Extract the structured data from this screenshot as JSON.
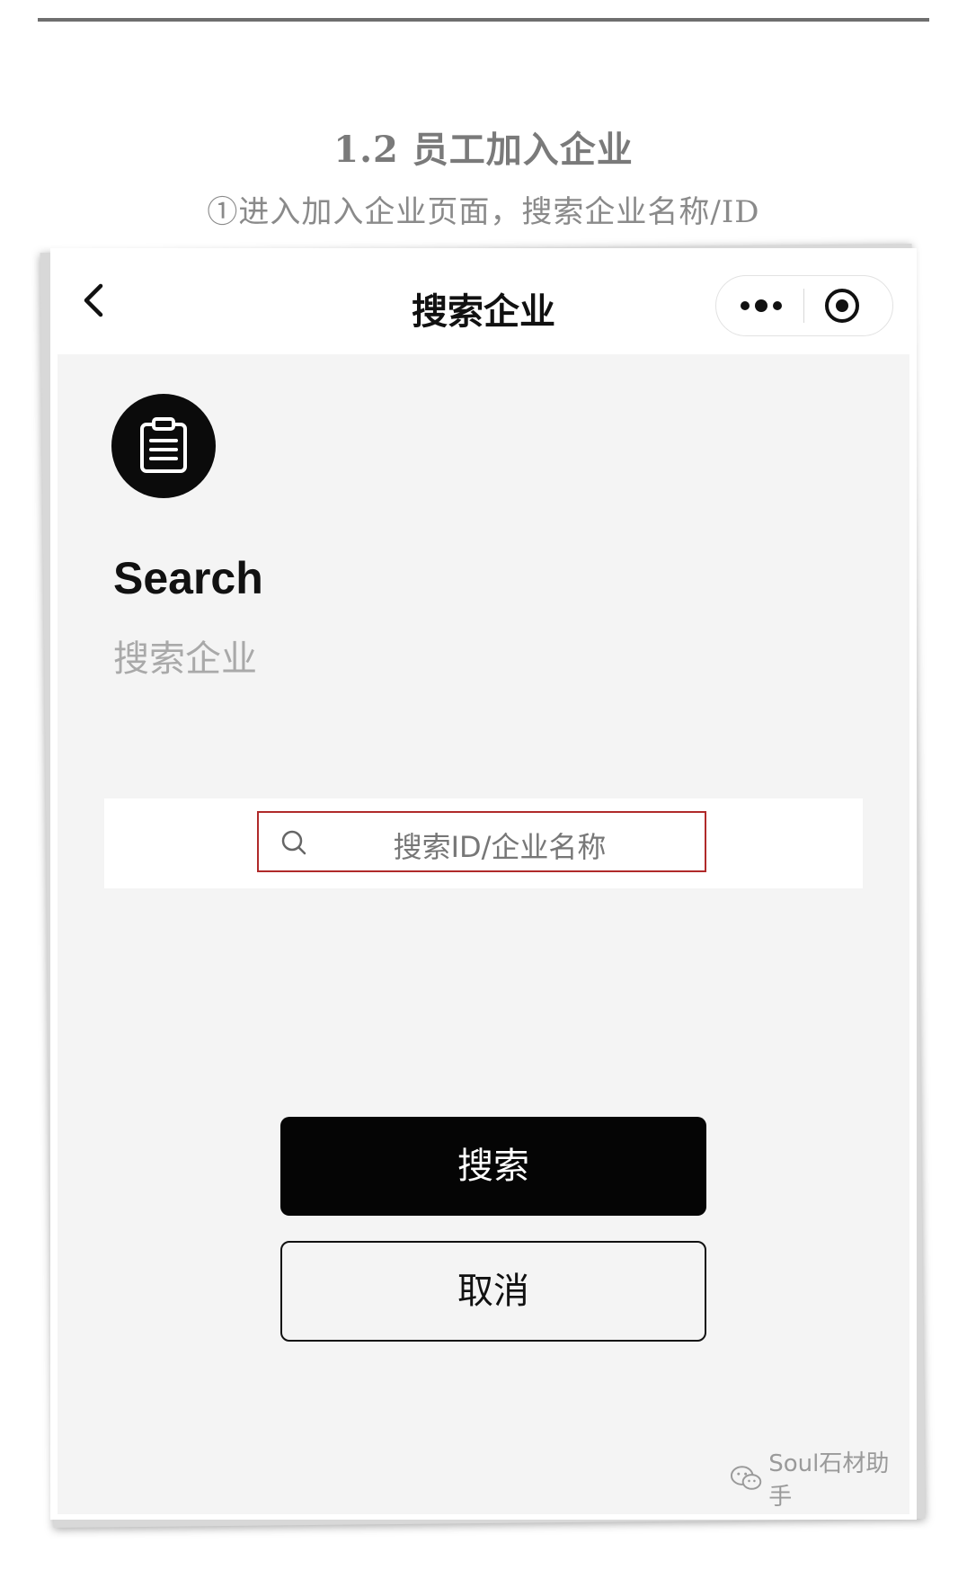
{
  "header": {
    "section_title": "1.2 员工加入企业",
    "instruction": "①进入加入企业页面，搜索企业名称/ID"
  },
  "navbar": {
    "title": "搜索企业",
    "back_icon": "chevron-left-icon",
    "more_icon": "more-dots-icon",
    "close_icon": "target-circle-icon"
  },
  "main": {
    "logo_icon": "clipboard-list-icon",
    "title": "Search",
    "subtitle": "搜索企业",
    "search": {
      "placeholder": "搜索ID/企业名称",
      "icon": "search-icon"
    },
    "buttons": {
      "search_label": "搜索",
      "cancel_label": "取消"
    }
  },
  "watermark": {
    "text": "Soul石材助手",
    "icon": "wechat-icon"
  },
  "colors": {
    "primary_button": "#050505",
    "highlight_border": "#b02a2a",
    "content_bg": "#f4f4f4",
    "muted_text": "#a9a9a9"
  }
}
